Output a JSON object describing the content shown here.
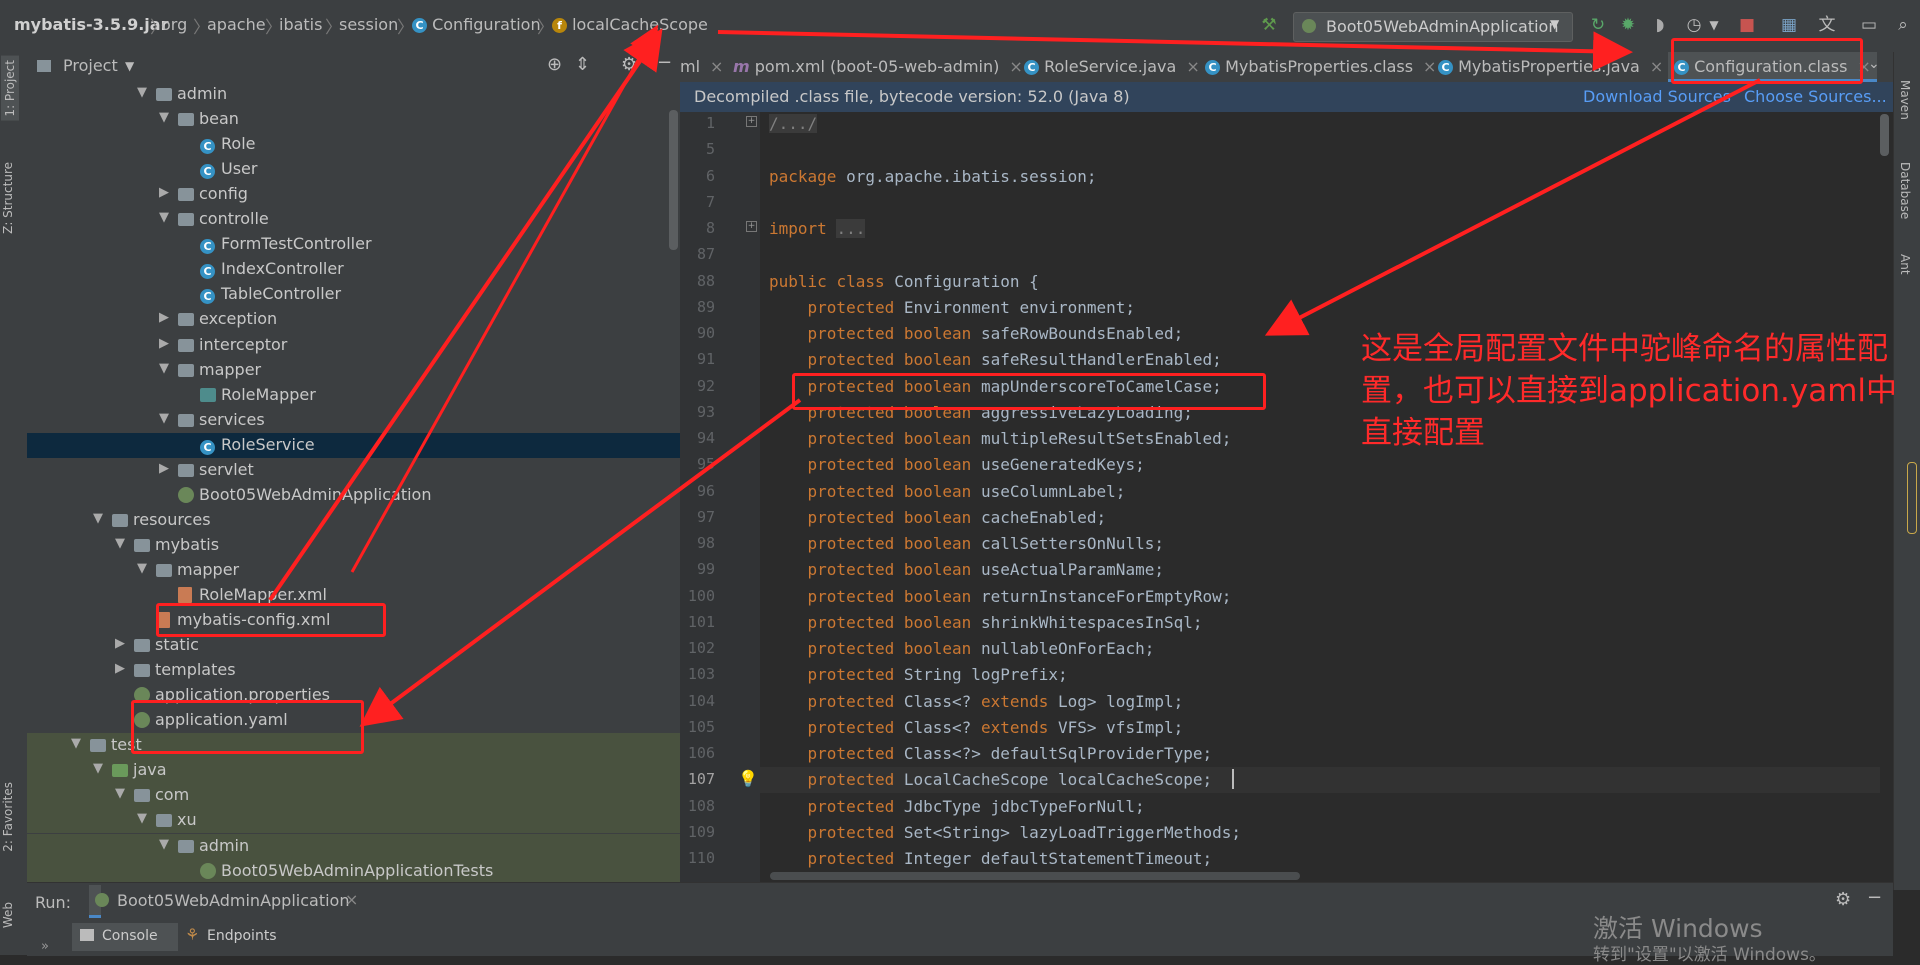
{
  "breadcrumb": {
    "jar": "mybatis-3.5.9.jar",
    "parts": [
      "org",
      "apache",
      "ibatis",
      "session"
    ],
    "class": "Configuration",
    "field": "localCacheScope"
  },
  "toolbar": {
    "run_config": "Boot05WebAdminApplication",
    "icons": [
      "hammer-icon",
      "rerun-icon",
      "debug-icon",
      "coverage-icon",
      "profile-icon",
      "stop-icon",
      "project-structure-icon",
      "translate-icon",
      "terminal-icon",
      "search-icon"
    ]
  },
  "left_strip": {
    "project": "1: Project",
    "structure": "Z: Structure",
    "favorites": "2: Favorites",
    "web": "Web"
  },
  "right_strip": {
    "maven": "Maven",
    "database": "Database",
    "ant": "Ant"
  },
  "project_panel": {
    "title": "Project",
    "tree": [
      {
        "label": "admin",
        "icon": "folder",
        "arrow": "down",
        "depth": 5,
        "y": 0
      },
      {
        "label": "bean",
        "icon": "folder",
        "arrow": "down",
        "depth": 6,
        "y": 1
      },
      {
        "label": "Role",
        "icon": "class",
        "arrow": "",
        "depth": 7,
        "y": 2
      },
      {
        "label": "User",
        "icon": "class",
        "arrow": "",
        "depth": 7,
        "y": 3
      },
      {
        "label": "config",
        "icon": "folder",
        "arrow": "right",
        "depth": 6,
        "y": 4
      },
      {
        "label": "controlle",
        "icon": "folder",
        "arrow": "down",
        "depth": 6,
        "y": 5
      },
      {
        "label": "FormTestController",
        "icon": "class",
        "arrow": "",
        "depth": 7,
        "y": 6
      },
      {
        "label": "IndexController",
        "icon": "class",
        "arrow": "",
        "depth": 7,
        "y": 7
      },
      {
        "label": "TableController",
        "icon": "class",
        "arrow": "",
        "depth": 7,
        "y": 8
      },
      {
        "label": "exception",
        "icon": "folder",
        "arrow": "right",
        "depth": 6,
        "y": 9
      },
      {
        "label": "interceptor",
        "icon": "folder",
        "arrow": "right",
        "depth": 6,
        "y": 10
      },
      {
        "label": "mapper",
        "icon": "folder",
        "arrow": "down",
        "depth": 6,
        "y": 11
      },
      {
        "label": "RoleMapper",
        "icon": "mapper",
        "arrow": "",
        "depth": 7,
        "y": 12
      },
      {
        "label": "services",
        "icon": "folder",
        "arrow": "down",
        "depth": 6,
        "y": 13
      },
      {
        "label": "RoleService",
        "icon": "class",
        "arrow": "",
        "depth": 7,
        "y": 14,
        "selected": true
      },
      {
        "label": "servlet",
        "icon": "folder",
        "arrow": "right",
        "depth": 6,
        "y": 15
      },
      {
        "label": "Boot05WebAdminApplication",
        "icon": "spring",
        "arrow": "",
        "depth": 6,
        "y": 16
      },
      {
        "label": "resources",
        "icon": "folder",
        "arrow": "down",
        "depth": 3,
        "y": 17
      },
      {
        "label": "mybatis",
        "icon": "folder",
        "arrow": "down",
        "depth": 4,
        "y": 18
      },
      {
        "label": "mapper",
        "icon": "folder",
        "arrow": "down",
        "depth": 5,
        "y": 19
      },
      {
        "label": "RoleMapper.xml",
        "icon": "xml",
        "arrow": "",
        "depth": 6,
        "y": 20
      },
      {
        "label": "mybatis-config.xml",
        "icon": "xml",
        "arrow": "",
        "depth": 5,
        "y": 21
      },
      {
        "label": "static",
        "icon": "folder",
        "arrow": "right",
        "depth": 4,
        "y": 22
      },
      {
        "label": "templates",
        "icon": "folder",
        "arrow": "right",
        "depth": 4,
        "y": 23
      },
      {
        "label": "application.properties",
        "icon": "spring",
        "arrow": "",
        "depth": 4,
        "y": 24
      },
      {
        "label": "application.yaml",
        "icon": "spring",
        "arrow": "",
        "depth": 4,
        "y": 25
      },
      {
        "label": "test",
        "icon": "folder",
        "arrow": "down",
        "depth": 2,
        "y": 26,
        "test": true
      },
      {
        "label": "java",
        "icon": "folder-green",
        "arrow": "down",
        "depth": 3,
        "y": 27,
        "test": true
      },
      {
        "label": "com",
        "icon": "folder",
        "arrow": "down",
        "depth": 4,
        "y": 28,
        "test": true
      },
      {
        "label": "xu",
        "icon": "folder",
        "arrow": "down",
        "depth": 5,
        "y": 29,
        "test": true
      },
      {
        "label": "admin",
        "icon": "folder",
        "arrow": "down",
        "depth": 6,
        "y": 30,
        "test": true
      },
      {
        "label": "Boot05WebAdminApplicationTests",
        "icon": "spring",
        "arrow": "",
        "depth": 7,
        "y": 31,
        "test": true
      }
    ]
  },
  "tabs": [
    {
      "label": "ml",
      "icon": ""
    },
    {
      "label": "pom.xml (boot-05-web-admin)",
      "icon": "m"
    },
    {
      "label": "RoleService.java",
      "icon": "c"
    },
    {
      "label": "MybatisProperties.class",
      "icon": "c"
    },
    {
      "label": "MybatisProperties.java",
      "icon": "c"
    },
    {
      "label": "Configuration.class",
      "icon": "c",
      "active": true
    }
  ],
  "notice": {
    "text": "Decompiled .class file, bytecode version: 52.0 (Java 8)",
    "download": "Download Sources",
    "choose": "Choose Sources..."
  },
  "code": {
    "lines": [
      {
        "n": "1",
        "t": "/.../"
      },
      {
        "n": "5",
        "t": ""
      },
      {
        "n": "6",
        "t": "package org.apache.ibatis.session;"
      },
      {
        "n": "7",
        "t": ""
      },
      {
        "n": "8",
        "t": "import ..."
      },
      {
        "n": "87",
        "t": ""
      },
      {
        "n": "88",
        "t": "public class Configuration {"
      },
      {
        "n": "89",
        "t": "    protected Environment environment;"
      },
      {
        "n": "90",
        "t": "    protected boolean safeRowBoundsEnabled;"
      },
      {
        "n": "91",
        "t": "    protected boolean safeResultHandlerEnabled;"
      },
      {
        "n": "92",
        "t": "    protected boolean mapUnderscoreToCamelCase;"
      },
      {
        "n": "93",
        "t": "    protected boolean aggressiveLazyLoading;"
      },
      {
        "n": "94",
        "t": "    protected boolean multipleResultSetsEnabled;"
      },
      {
        "n": "95",
        "t": "    protected boolean useGeneratedKeys;"
      },
      {
        "n": "96",
        "t": "    protected boolean useColumnLabel;"
      },
      {
        "n": "97",
        "t": "    protected boolean cacheEnabled;"
      },
      {
        "n": "98",
        "t": "    protected boolean callSettersOnNulls;"
      },
      {
        "n": "99",
        "t": "    protected boolean useActualParamName;"
      },
      {
        "n": "100",
        "t": "    protected boolean returnInstanceForEmptyRow;"
      },
      {
        "n": "101",
        "t": "    protected boolean shrinkWhitespacesInSql;"
      },
      {
        "n": "102",
        "t": "    protected boolean nullableOnForEach;"
      },
      {
        "n": "103",
        "t": "    protected String logPrefix;"
      },
      {
        "n": "104",
        "t": "    protected Class<? extends Log> logImpl;"
      },
      {
        "n": "105",
        "t": "    protected Class<? extends VFS> vfsImpl;"
      },
      {
        "n": "106",
        "t": "    protected Class<?> defaultSqlProviderType;"
      },
      {
        "n": "107",
        "t": "    protected LocalCacheScope localCacheScope;",
        "current": true
      },
      {
        "n": "108",
        "t": "    protected JdbcType jdbcTypeForNull;"
      },
      {
        "n": "109",
        "t": "    protected Set<String> lazyLoadTriggerMethods;"
      },
      {
        "n": "110",
        "t": "    protected Integer defaultStatementTimeout;"
      }
    ]
  },
  "run_panel": {
    "label": "Run:",
    "config": "Boot05WebAdminApplication",
    "console": "Console",
    "endpoints": "Endpoints"
  },
  "annotation": {
    "text": "这是全局配置文件中驼峰命名的属性配置，也可以直接到application.yaml中直接配置",
    "color": "#ff2020"
  },
  "watermark": {
    "line1": "激活 Windows",
    "line2": "转到\"设置\"以激活 Windows。"
  }
}
